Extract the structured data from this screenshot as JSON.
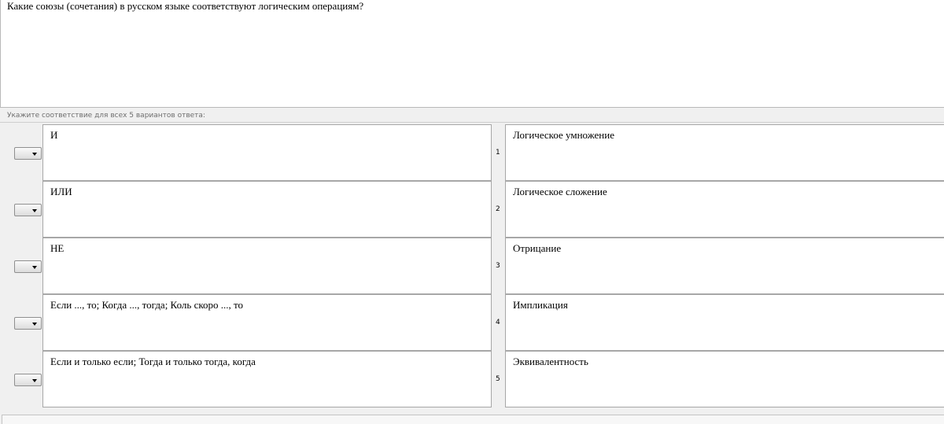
{
  "question": {
    "text": "Какие союзы (сочетания) в русском языке соответствуют логическим операциям?"
  },
  "instruction": "Укажите соответствие для всех 5 вариантов ответа:",
  "colors": {
    "background": "#f0f0f0",
    "cell_border": "#a7a7a7",
    "instruction_text": "#6e6e6e"
  },
  "rows": [
    {
      "select_value": "",
      "left": "И",
      "number": "1",
      "right": "Логическое умножение"
    },
    {
      "select_value": "",
      "left": "ИЛИ",
      "number": "2",
      "right": "Логическое сложение"
    },
    {
      "select_value": "",
      "left": "НЕ",
      "number": "3",
      "right": "Отрицание"
    },
    {
      "select_value": "",
      "left": "Если ..., то; Когда ..., тогда; Коль скоро ..., то",
      "number": "4",
      "right": "Импликация"
    },
    {
      "select_value": "",
      "left": "Если и только если; Тогда и только тогда, когда",
      "number": "5",
      "right": "Эквивалентность"
    }
  ],
  "icons": {
    "dropdown": "chevron-down-icon"
  }
}
